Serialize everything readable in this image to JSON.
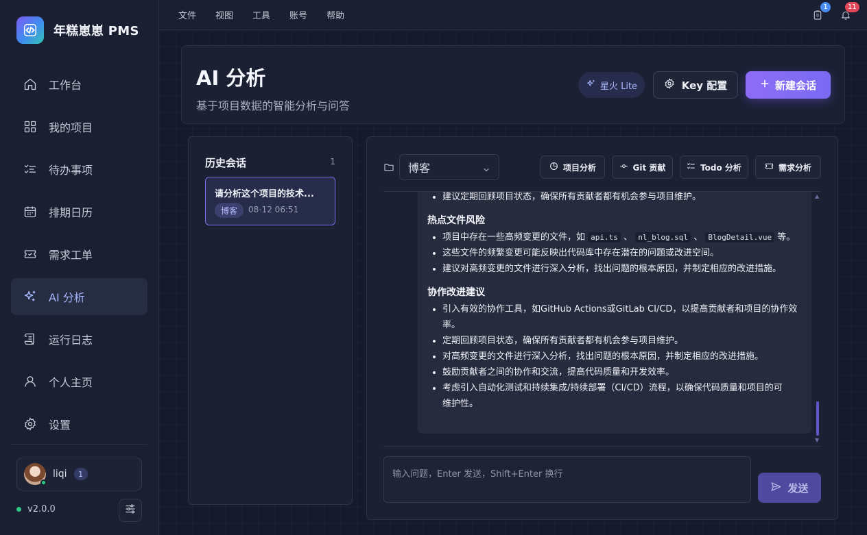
{
  "app": {
    "name": "年糕崽崽 PMS",
    "version": "v2.0.0"
  },
  "menubar": {
    "items": [
      "文件",
      "视图",
      "工具",
      "账号",
      "帮助"
    ],
    "clipboard_badge": "1",
    "bell_badge": "11"
  },
  "sidebar": {
    "items": [
      {
        "label": "工作台",
        "icon": "home-icon"
      },
      {
        "label": "我的项目",
        "icon": "grid-icon"
      },
      {
        "label": "待办事项",
        "icon": "checklist-icon"
      },
      {
        "label": "排期日历",
        "icon": "calendar-icon"
      },
      {
        "label": "需求工单",
        "icon": "ticket-icon"
      },
      {
        "label": "AI 分析",
        "icon": "sparkle-icon",
        "active": true
      },
      {
        "label": "运行日志",
        "icon": "scroll-icon"
      },
      {
        "label": "个人主页",
        "icon": "user-icon"
      },
      {
        "label": "设置",
        "icon": "gear-icon"
      }
    ],
    "user": {
      "name": "liqi",
      "badge": "1"
    }
  },
  "header": {
    "title": "AI 分析",
    "subtitle": "基于项目数据的智能分析与问答",
    "model_label": "星火 Lite",
    "key_button": "Key 配置",
    "new_button": "新建会话"
  },
  "history": {
    "title": "历史会话",
    "count": "1",
    "items": [
      {
        "title": "请分析这个项目的技术...",
        "tag": "博客",
        "time": "08-12 06:51"
      }
    ]
  },
  "chat": {
    "project": "博客",
    "quick_actions": [
      "项目分析",
      "Git 贡献",
      "Todo 分析",
      "需求分析"
    ],
    "input_placeholder": "输入问题，Enter 发送，Shift+Enter 换行",
    "send_label": "发送",
    "message": {
      "line_top": "建议定期回顾项目状态，确保所有贡献者都有机会参与项目维护。",
      "section1_title": "热点文件风险",
      "s1_b1_pre": "项目中存在一些高频变更的文件，如",
      "s1_code1": "api.ts",
      "s1_sep1": "、",
      "s1_code2": "nl_blog.sql",
      "s1_sep2": "、",
      "s1_code3": "BlogDetail.vue",
      "s1_b1_post": "等。",
      "s1_b2": "这些文件的频繁变更可能反映出代码库中存在潜在的问题或改进空间。",
      "s1_b3": "建议对高频变更的文件进行深入分析，找出问题的根本原因，并制定相应的改进措施。",
      "section2_title": "协作改进建议",
      "s2_b1_line1": "引入有效的协作工具，如GitHub Actions或GitLab CI/CD，以提高贡献者和项目的协作效",
      "s2_b1_line2": "率。",
      "s2_b2": "定期回顾项目状态，确保所有贡献者都有机会参与项目维护。",
      "s2_b3": "对高频变更的文件进行深入分析，找出问题的根本原因，并制定相应的改进措施。",
      "s2_b4": "鼓励贡献者之间的协作和交流，提高代码质量和开发效率。",
      "s2_b5_line1": "考虑引入自动化测试和持续集成/持续部署（CI/CD）流程，以确保代码质量和项目的可",
      "s2_b5_line2": "维护性。"
    }
  }
}
